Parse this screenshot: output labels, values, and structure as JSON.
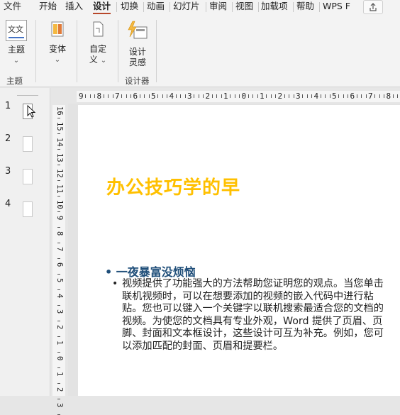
{
  "menu": {
    "tabs": [
      "文件",
      "开始",
      "插入",
      "设计",
      "切换",
      "动画",
      "幻灯片",
      "审阅",
      "视图",
      "加载项",
      "帮助",
      "WPS F"
    ],
    "active_tab": "设计"
  },
  "ribbon": {
    "theme_label": "主题",
    "theme_group_label": "主题",
    "theme_icon_text": "文文",
    "variant_label": "变体",
    "custom_label_1": "自定",
    "custom_label_2": "义",
    "design_ideas_1": "设计",
    "design_ideas_2": "灵感",
    "designer_group_label": "设计器"
  },
  "ruler": {
    "top_numbers": [
      "9",
      "8",
      "7",
      "6",
      "5",
      "4",
      "3",
      "2",
      "1",
      "0",
      "1",
      "2",
      "3",
      "4",
      "5",
      "6",
      "7",
      "8"
    ],
    "left_numbers": [
      "16",
      "15",
      "14",
      "13",
      "12",
      "11",
      "10",
      "9",
      "8",
      "7",
      "6",
      "5",
      "4",
      "3",
      "2",
      "1",
      "0",
      "1",
      "2",
      "3"
    ]
  },
  "thumbnails": [
    "1",
    "2",
    "3",
    "4"
  ],
  "slide": {
    "title": "办公技巧学的早",
    "bullet_level1": "一夜暴富没烦恼",
    "bullet_level2": "视频提供了功能强大的方法帮助您证明您的观点。当您单击联机视频时，可以在想要添加的视频的嵌入代码中进行粘贴。您也可以键入一个关键字以联机搜索最适合您的文档的视频。为使您的文档具有专业外观，Word 提供了页眉、页脚、封面和文本框设计，这些设计可互为补充。例如，您可以添加匹配的封面、页眉和提要栏。"
  },
  "colors": {
    "accent_tab": "#b7472a",
    "title": "#ffc000",
    "bullet1": "#1f4e79"
  }
}
